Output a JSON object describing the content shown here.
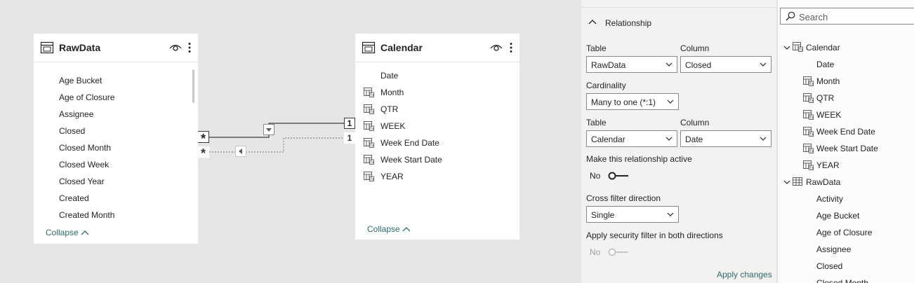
{
  "colors": {
    "accent": "#2b6c6a",
    "canvas": "#e6e6e6",
    "pane": "#f3f2f1"
  },
  "raw_card": {
    "title": "RawData",
    "fields": [
      "Age Bucket",
      "Age of Closure",
      "Assignee",
      "Closed",
      "Closed Month",
      "Closed Week",
      "Closed Year",
      "Created",
      "Created Month"
    ],
    "collapse": "Collapse"
  },
  "calendar_card": {
    "title": "Calendar",
    "fields": [
      {
        "label": "Date",
        "icon": "none"
      },
      {
        "label": "Month",
        "icon": "calculated-column-icon"
      },
      {
        "label": "QTR",
        "icon": "calculated-column-icon"
      },
      {
        "label": "WEEK",
        "icon": "calculated-column-icon"
      },
      {
        "label": "Week End Date",
        "icon": "calculated-column-icon"
      },
      {
        "label": "Week Start Date",
        "icon": "calculated-column-icon"
      },
      {
        "label": "YEAR",
        "icon": "calculated-column-icon"
      }
    ],
    "collapse": "Collapse"
  },
  "relationship_markers": {
    "many_active": "*",
    "many_inactive": "*",
    "one_active": "1",
    "one_inactive": "1"
  },
  "properties": {
    "section_title": "Relationship",
    "table1_label": "Table",
    "table1_value": "RawData",
    "column1_label": "Column",
    "column1_value": "Closed",
    "cardinality_label": "Cardinality",
    "cardinality_value": "Many to one (*:1)",
    "table2_label": "Table",
    "table2_value": "Calendar",
    "column2_label": "Column",
    "column2_value": "Date",
    "active_label": "Make this relationship active",
    "active_value": "No",
    "crossfilter_label": "Cross filter direction",
    "crossfilter_value": "Single",
    "security_label": "Apply security filter in both directions",
    "security_value": "No",
    "apply_label": "Apply changes"
  },
  "fields_pane": {
    "search_placeholder": "Search",
    "tables": [
      {
        "name": "Calendar",
        "icon": "calculated-table-icon",
        "fields": [
          {
            "label": "Date",
            "icon": "none"
          },
          {
            "label": "Month",
            "icon": "calculated-column-icon"
          },
          {
            "label": "QTR",
            "icon": "calculated-column-icon"
          },
          {
            "label": "WEEK",
            "icon": "calculated-column-icon"
          },
          {
            "label": "Week End Date",
            "icon": "calculated-column-icon"
          },
          {
            "label": "Week Start Date",
            "icon": "calculated-column-icon"
          },
          {
            "label": "YEAR",
            "icon": "calculated-column-icon"
          }
        ]
      },
      {
        "name": "RawData",
        "icon": "table-icon",
        "fields": [
          {
            "label": "Activity",
            "icon": "none"
          },
          {
            "label": "Age Bucket",
            "icon": "none"
          },
          {
            "label": "Age of Closure",
            "icon": "none"
          },
          {
            "label": "Assignee",
            "icon": "none"
          },
          {
            "label": "Closed",
            "icon": "none"
          },
          {
            "label": "Closed Month",
            "icon": "none"
          }
        ]
      }
    ]
  }
}
